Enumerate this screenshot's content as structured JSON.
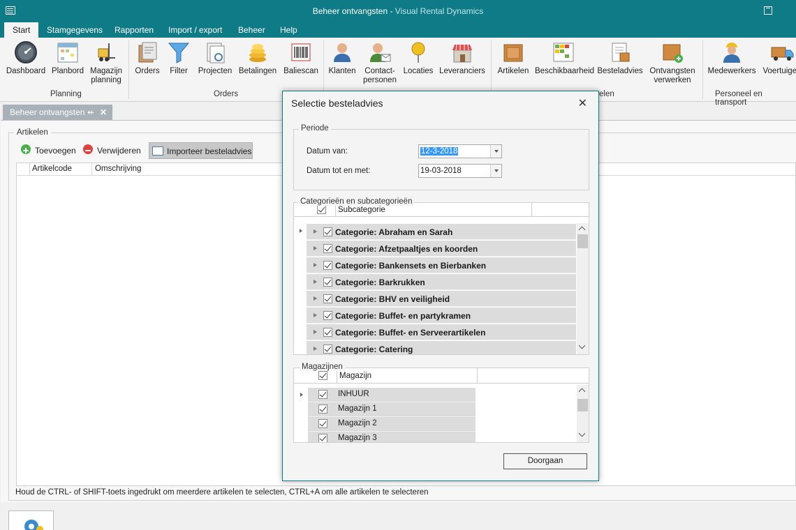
{
  "window": {
    "title": "Beheer ontvangsten",
    "app_name": "Visual Rental Dynamics"
  },
  "menu": [
    "Start",
    "Stamgegevens",
    "Rapporten",
    "Import / export",
    "Beheer",
    "Help"
  ],
  "ribbon": {
    "buttons": [
      {
        "label": "Dashboard",
        "icon": "dashboard-icon"
      },
      {
        "label": "Planbord",
        "icon": "calendar-icon"
      },
      {
        "label": "Magazijn\nplanning",
        "icon": "forklift-icon"
      },
      {
        "label": "Orders",
        "icon": "orders-icon"
      },
      {
        "label": "Filter",
        "icon": "funnel-icon"
      },
      {
        "label": "Projecten",
        "icon": "projects-icon"
      },
      {
        "label": "Betalingen",
        "icon": "coins-icon"
      },
      {
        "label": "Baliescan",
        "icon": "barcode-icon"
      },
      {
        "label": "Klanten",
        "icon": "customer-icon"
      },
      {
        "label": "Contact-\npersonen",
        "icon": "contact-icon"
      },
      {
        "label": "Locaties",
        "icon": "location-pin-icon"
      },
      {
        "label": "Leveranciers",
        "icon": "store-icon"
      },
      {
        "label": "Artikelen",
        "icon": "box-icon"
      },
      {
        "label": "Beschikbaarheid",
        "icon": "availability-grid-icon"
      },
      {
        "label": "Besteladvies",
        "icon": "order-advice-icon"
      },
      {
        "label": "Ontvangsten\nverwerken",
        "icon": "receive-box-icon"
      },
      {
        "label": "Medewerkers",
        "icon": "worker-icon"
      },
      {
        "label": "Voertuigen",
        "icon": "truck-icon"
      }
    ],
    "groups": [
      "Planning",
      "Orders",
      "elen",
      "Personeel en transport"
    ]
  },
  "document_tab": {
    "label": "Beheer ontvangsten",
    "pin_icon": "pin-icon",
    "close_icon": "close-icon"
  },
  "articles": {
    "group_label": "Artikelen",
    "toolbar": {
      "add": "Toevoegen",
      "remove": "Verwijderen",
      "import": "Importeer besteladvies"
    },
    "columns": [
      "Artikelcode",
      "Omschrijving"
    ],
    "hint": "Houd de CTRL- of SHIFT-toets ingedrukt om meerdere artikelen te selecten, CTRL+A om alle artikelen te selecteren"
  },
  "dialog": {
    "title": "Selectie besteladvies",
    "periode": {
      "label": "Periode",
      "from_label": "Datum van:",
      "from_value": "12-3-2018",
      "to_label": "Datum tot en met:",
      "to_value": "19-03-2018"
    },
    "categories": {
      "label": "Categorieën en subcategorieën",
      "column": "Subcategorie",
      "rows": [
        "Categorie: Abraham en Sarah",
        "Categorie: Afzetpaaltjes en koorden",
        "Categorie: Bankensets en Bierbanken",
        "Categorie: Barkrukken",
        "Categorie: BHV en veiligheid",
        "Categorie: Buffet- en partykramen",
        "Categorie: Buffet- en Serveerartikelen",
        "Categorie: Catering"
      ]
    },
    "warehouses": {
      "label": "Magazijnen",
      "column": "Magazijn",
      "rows": [
        "INHUUR",
        "Magazijn 1",
        "Magazijn 2",
        "Magazijn 3"
      ]
    },
    "continue_button": "Doorgaan"
  },
  "colors": {
    "accent": "#0f7b86",
    "row_bg": "#dcdcdc",
    "selection": "#3399ff"
  }
}
